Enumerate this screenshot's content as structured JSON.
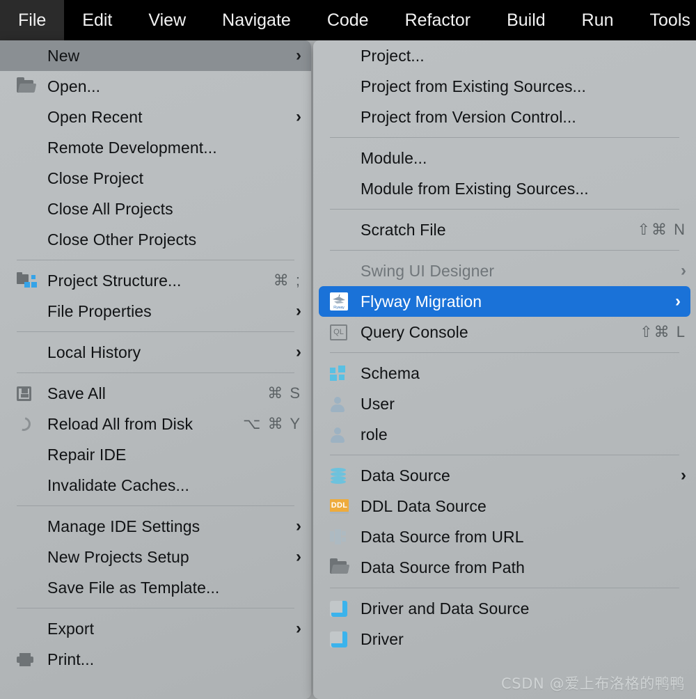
{
  "menubar": {
    "items": [
      {
        "label": "File",
        "active": true
      },
      {
        "label": "Edit",
        "active": false
      },
      {
        "label": "View",
        "active": false
      },
      {
        "label": "Navigate",
        "active": false
      },
      {
        "label": "Code",
        "active": false
      },
      {
        "label": "Refactor",
        "active": false
      },
      {
        "label": "Build",
        "active": false
      },
      {
        "label": "Run",
        "active": false
      },
      {
        "label": "Tools",
        "active": false
      }
    ]
  },
  "file_menu": {
    "items": [
      {
        "label": "New",
        "icon": "none",
        "submenu": true,
        "shortcut": "",
        "state": "selected"
      },
      {
        "label": "Open...",
        "icon": "folder-icon",
        "submenu": false,
        "shortcut": "",
        "state": "normal"
      },
      {
        "label": "Open Recent",
        "icon": "none",
        "submenu": true,
        "shortcut": "",
        "state": "normal"
      },
      {
        "label": "Remote Development...",
        "icon": "none",
        "submenu": false,
        "shortcut": "",
        "state": "normal"
      },
      {
        "label": "Close Project",
        "icon": "none",
        "submenu": false,
        "shortcut": "",
        "state": "normal"
      },
      {
        "label": "Close All Projects",
        "icon": "none",
        "submenu": false,
        "shortcut": "",
        "state": "normal"
      },
      {
        "label": "Close Other Projects",
        "icon": "none",
        "submenu": false,
        "shortcut": "",
        "state": "normal"
      },
      {
        "separator": true
      },
      {
        "label": "Project Structure...",
        "icon": "project-structure-icon",
        "submenu": false,
        "shortcut": "⌘ ;",
        "state": "normal"
      },
      {
        "label": "File Properties",
        "icon": "none",
        "submenu": true,
        "shortcut": "",
        "state": "normal"
      },
      {
        "separator": true
      },
      {
        "label": "Local History",
        "icon": "none",
        "submenu": true,
        "shortcut": "",
        "state": "normal"
      },
      {
        "separator": true
      },
      {
        "label": "Save All",
        "icon": "save-icon",
        "submenu": false,
        "shortcut": "⌘ S",
        "state": "normal"
      },
      {
        "label": "Reload All from Disk",
        "icon": "reload-icon",
        "submenu": false,
        "shortcut": "⌥ ⌘ Y",
        "state": "normal"
      },
      {
        "label": "Repair IDE",
        "icon": "none",
        "submenu": false,
        "shortcut": "",
        "state": "normal"
      },
      {
        "label": "Invalidate Caches...",
        "icon": "none",
        "submenu": false,
        "shortcut": "",
        "state": "normal"
      },
      {
        "separator": true
      },
      {
        "label": "Manage IDE Settings",
        "icon": "none",
        "submenu": true,
        "shortcut": "",
        "state": "normal"
      },
      {
        "label": "New Projects Setup",
        "icon": "none",
        "submenu": true,
        "shortcut": "",
        "state": "normal"
      },
      {
        "label": "Save File as Template...",
        "icon": "none",
        "submenu": false,
        "shortcut": "",
        "state": "normal"
      },
      {
        "separator": true
      },
      {
        "label": "Export",
        "icon": "none",
        "submenu": true,
        "shortcut": "",
        "state": "normal"
      },
      {
        "label": "Print...",
        "icon": "print-icon",
        "submenu": false,
        "shortcut": "",
        "state": "normal"
      }
    ]
  },
  "new_submenu": {
    "items": [
      {
        "label": "Project...",
        "icon": "none",
        "submenu": false,
        "shortcut": "",
        "state": "normal"
      },
      {
        "label": "Project from Existing Sources...",
        "icon": "none",
        "submenu": false,
        "shortcut": "",
        "state": "normal"
      },
      {
        "label": "Project from Version Control...",
        "icon": "none",
        "submenu": false,
        "shortcut": "",
        "state": "normal"
      },
      {
        "separator": true
      },
      {
        "label": "Module...",
        "icon": "none",
        "submenu": false,
        "shortcut": "",
        "state": "normal"
      },
      {
        "label": "Module from Existing Sources...",
        "icon": "none",
        "submenu": false,
        "shortcut": "",
        "state": "normal"
      },
      {
        "separator": true
      },
      {
        "label": "Scratch File",
        "icon": "blank",
        "submenu": false,
        "shortcut": "⇧⌘ N",
        "state": "normal"
      },
      {
        "separator": true
      },
      {
        "label": "Swing UI Designer",
        "icon": "blank",
        "submenu": true,
        "shortcut": "",
        "state": "disabled"
      },
      {
        "label": "Flyway Migration",
        "icon": "flyway-icon",
        "submenu": true,
        "shortcut": "",
        "state": "highlighted"
      },
      {
        "label": "Query Console",
        "icon": "query-console-icon",
        "submenu": false,
        "shortcut": "⇧⌘ L",
        "state": "normal"
      },
      {
        "separator": true
      },
      {
        "label": "Schema",
        "icon": "schema-icon",
        "submenu": false,
        "shortcut": "",
        "state": "normal"
      },
      {
        "label": "User",
        "icon": "user-icon",
        "submenu": false,
        "shortcut": "",
        "state": "normal"
      },
      {
        "label": "role",
        "icon": "role-icon",
        "submenu": false,
        "shortcut": "",
        "state": "normal"
      },
      {
        "separator": true
      },
      {
        "label": "Data Source",
        "icon": "database-icon",
        "submenu": true,
        "shortcut": "",
        "state": "normal"
      },
      {
        "label": "DDL Data Source",
        "icon": "ddl-icon",
        "submenu": false,
        "shortcut": "",
        "state": "normal"
      },
      {
        "label": "Data Source from URL",
        "icon": "data-source-url-icon",
        "submenu": false,
        "shortcut": "",
        "state": "normal"
      },
      {
        "label": "Data Source from Path",
        "icon": "folder-icon",
        "submenu": false,
        "shortcut": "",
        "state": "normal"
      },
      {
        "separator": true
      },
      {
        "label": "Driver and Data Source",
        "icon": "driver-icon",
        "submenu": false,
        "shortcut": "",
        "state": "normal"
      },
      {
        "label": "Driver",
        "icon": "driver-icon",
        "submenu": false,
        "shortcut": "",
        "state": "normal"
      }
    ]
  },
  "watermark": {
    "text": "CSDN @爱上布洛格的鸭鸭"
  },
  "colors": {
    "menubar_bg": "#000000",
    "menubar_active_bg": "#2b2b2b",
    "menu_bg": "#b6babc",
    "selected_gray": "#8a8f93",
    "highlight_blue": "#1a72d8",
    "text": "#101214",
    "disabled_text": "#70767a",
    "shortcut_text": "#5c6265",
    "separator": "#9ba0a3"
  },
  "icon_glyphs": {
    "submenu_arrow": "›",
    "ddl_label": "DDL",
    "ql_label": "QL"
  }
}
